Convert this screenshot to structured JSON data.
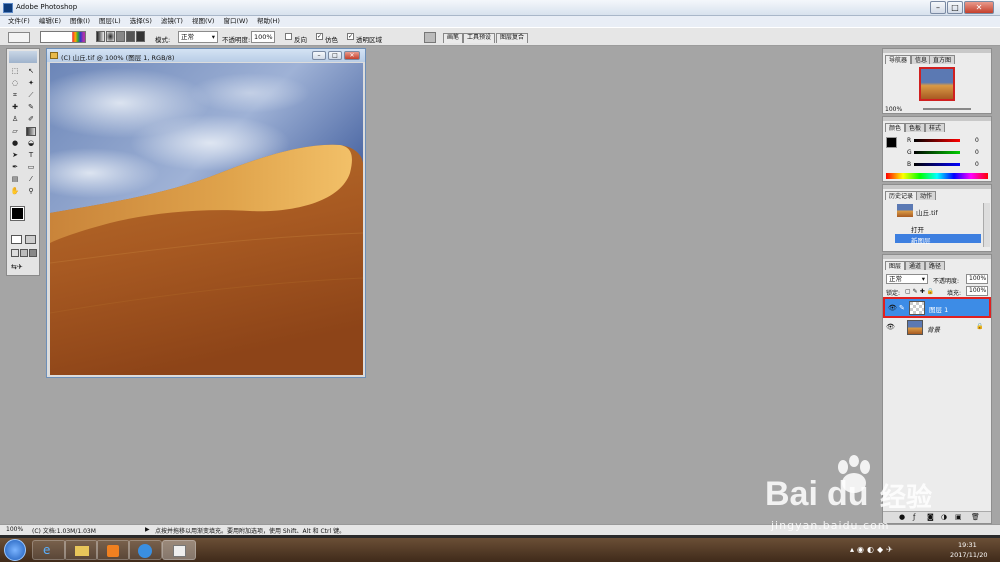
{
  "app": {
    "title": "Adobe Photoshop"
  },
  "menu": [
    "文件(F)",
    "编辑(E)",
    "图像(I)",
    "图层(L)",
    "选择(S)",
    "滤镜(T)",
    "视图(V)",
    "窗口(W)",
    "帮助(H)"
  ],
  "options": {
    "mode_label": "模式:",
    "mode_value": "正常",
    "opacity_label": "不透明度:",
    "opacity_value": "100%",
    "reverse": "反向",
    "dither": "仿色",
    "transparency": "透明区域"
  },
  "dock_tabs": [
    "画笔",
    "工具预设",
    "图层复合"
  ],
  "document": {
    "title": "(C) 山丘.tif @ 100% (图层 1, RGB/8)"
  },
  "navigator": {
    "tabs": [
      "导航器",
      "信息",
      "直方图"
    ],
    "zoom": "100%"
  },
  "color": {
    "tabs": [
      "颜色",
      "色板",
      "样式"
    ],
    "channels": [
      {
        "label": "R",
        "value": "0",
        "color": "#d02020"
      },
      {
        "label": "G",
        "value": "0",
        "color": "#20a020"
      },
      {
        "label": "B",
        "value": "0",
        "color": "#2030c0"
      }
    ]
  },
  "history": {
    "tabs": [
      "历史记录",
      "动作"
    ],
    "snapshot": "山丘.tif",
    "items": [
      "打开",
      "新图层"
    ]
  },
  "layers": {
    "tabs": [
      "图层",
      "通道",
      "路径"
    ],
    "blend": "正常",
    "opacity_label": "不透明度:",
    "opacity": "100%",
    "lock_label": "锁定:",
    "fill_label": "填充:",
    "fill": "100%",
    "items": [
      {
        "name": "图层 1",
        "selected": true
      },
      {
        "name": "背景",
        "selected": false
      }
    ]
  },
  "status": {
    "zoom": "100%",
    "doc": "(C) 文档:1.03M/1.03M",
    "hint": "点按并拖移以用渐变填充。要用附加选项，使用 Shift、Alt 和 Ctrl 键。"
  },
  "taskbar": {
    "time": "19:31",
    "date": "2017/11/20"
  },
  "watermark": {
    "brand": "Bai",
    "brand2": "经验",
    "url": "jingyan.baidu.com"
  }
}
